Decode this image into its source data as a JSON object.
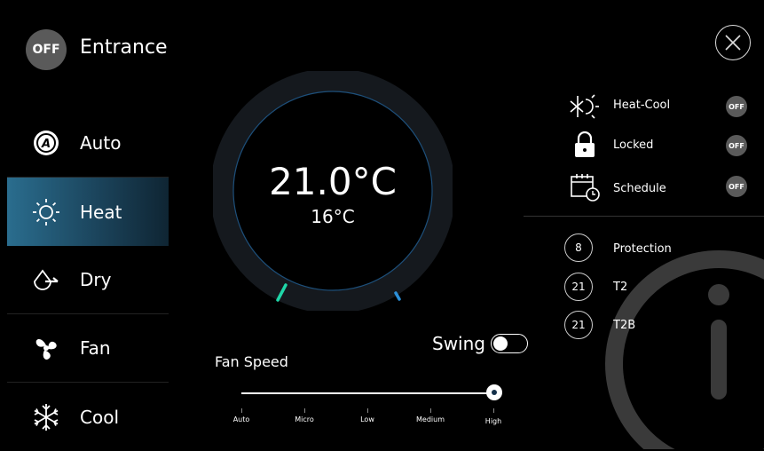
{
  "header": {
    "power_state": "OFF",
    "zone_name": "Entrance"
  },
  "modes": [
    {
      "label": "Auto",
      "icon": "auto-icon",
      "active": false
    },
    {
      "label": "Heat",
      "icon": "sun-icon",
      "active": true
    },
    {
      "label": "Dry",
      "icon": "droplet-icon",
      "active": false
    },
    {
      "label": "Fan",
      "icon": "fan-icon",
      "active": false
    },
    {
      "label": "Cool",
      "icon": "snowflake-icon",
      "active": false
    }
  ],
  "thermostat": {
    "current_temp": "21.0°C",
    "set_temp": "16°C"
  },
  "swing": {
    "label": "Swing",
    "enabled": false
  },
  "fan_speed": {
    "label": "Fan Speed",
    "levels": [
      "Auto",
      "Micro",
      "Low",
      "Medium",
      "High"
    ],
    "selected": "High",
    "selected_index": 4
  },
  "features": [
    {
      "label": "Heat-Cool",
      "icon": "heat-cool-icon",
      "state": "OFF"
    },
    {
      "label": "Locked",
      "icon": "lock-icon",
      "state": "OFF"
    },
    {
      "label": "Schedule",
      "icon": "calendar-icon",
      "state": "OFF"
    }
  ],
  "readouts": [
    {
      "value": "8",
      "label": "Protection"
    },
    {
      "value": "21",
      "label": "T2"
    },
    {
      "value": "21",
      "label": "T2B"
    }
  ],
  "colors": {
    "accent_active_mode": "#2a6d8e",
    "badge_gray": "#5a5a5a",
    "current_marker": "#1fd6a8",
    "setpoint_marker": "#2b8fd8",
    "background": "#000000"
  }
}
